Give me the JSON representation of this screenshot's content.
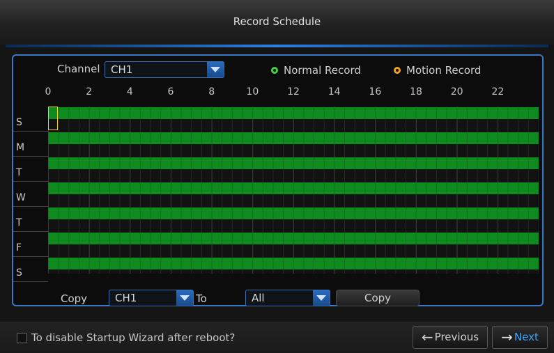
{
  "window": {
    "title": "Record Schedule"
  },
  "channel": {
    "label": "Channel",
    "value": "CH1"
  },
  "legend": {
    "normal": "Normal Record",
    "motion": "Motion Record",
    "normal_color": "#3fd23f",
    "motion_color": "#f0a020"
  },
  "hours": [
    "0",
    "2",
    "4",
    "6",
    "8",
    "10",
    "12",
    "14",
    "16",
    "18",
    "20",
    "22"
  ],
  "days": [
    {
      "label": "S",
      "mode": "normal",
      "coverage": 1.0
    },
    {
      "label": "M",
      "mode": "normal",
      "coverage": 1.0
    },
    {
      "label": "T",
      "mode": "normal",
      "coverage": 1.0
    },
    {
      "label": "W",
      "mode": "normal",
      "coverage": 1.0
    },
    {
      "label": "T",
      "mode": "normal",
      "coverage": 1.0
    },
    {
      "label": "F",
      "mode": "normal",
      "coverage": 1.0
    },
    {
      "label": "S",
      "mode": "normal",
      "coverage": 1.0
    }
  ],
  "copy": {
    "label": "Copy",
    "from": "CH1",
    "to_label": "To",
    "to": "All",
    "button": "Copy"
  },
  "footer": {
    "checkbox_label": "To disable Startup Wizard after reboot?",
    "checked": false,
    "previous": "Previous",
    "next": "Next",
    "next_color": "#3aa8ff"
  }
}
